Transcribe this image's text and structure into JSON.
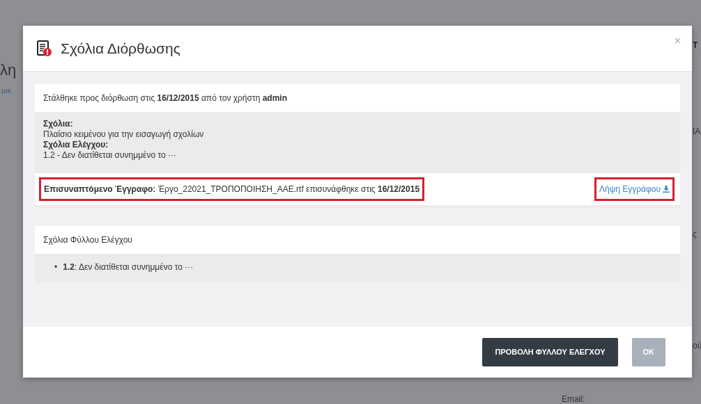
{
  "background": {
    "fragments": [
      {
        "text": "λη",
        "kind": "title"
      },
      {
        "text": "μικ",
        "kind": "link"
      },
      {
        "text": "Τ",
        "kind": "header"
      },
      {
        "text": "ΙΑ",
        "kind": "label"
      },
      {
        "text": "ς",
        "kind": "label"
      },
      {
        "text": "ού",
        "kind": "label"
      },
      {
        "text": "Email:",
        "kind": "label"
      }
    ]
  },
  "modal": {
    "title": "Σχόλια Διόρθωσης",
    "close": "×",
    "sent_panel": {
      "header": "Στάλθηκε προς διόρθωση στις **16/12/2015**  από τον χρήστη **admin**",
      "comments_label": "Σχόλια:",
      "comments": "Πλαίσιο κειμένου για την εισαγωγή σχολίων",
      "review_label": "Σχόλια Ελέγχου:",
      "review": "1.2 - Δεν διατίθεται συνημμένο το ···",
      "attachment": {
        "text": "**Επισυναπτόμενο Έγγραφο:** Έργο_22021_ΤΡΟΠΟΠΟΙΗΣΗ_ΑΑΕ.rtf επισυνάφθηκε στις **16/12/2015**",
        "highlighted": true
      },
      "download": {
        "label": "Λήψη Εγγράφου",
        "highlighted": true
      }
    },
    "checklist_panel": {
      "header": "Σχόλια Φύλλου Ελέγχου",
      "items": [
        {
          "marker": "•",
          "text": "**1.2**: Δεν διατίθεται συνημμένο το  ···"
        }
      ]
    },
    "buttons": [
      {
        "label": "ΠΡΟΒΟΛΗ ΦΥΛΛΟΥ ΕΛΕΓΧΟΥ",
        "disabled": false
      },
      {
        "label": "OK",
        "disabled": true
      }
    ]
  }
}
